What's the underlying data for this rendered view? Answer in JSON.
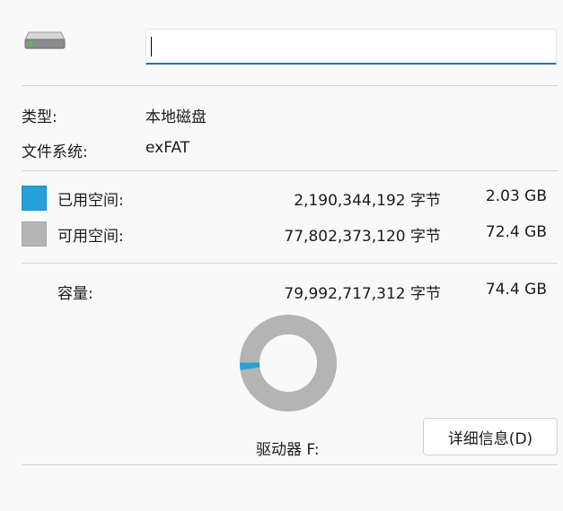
{
  "name_input": {
    "value": ""
  },
  "info": {
    "type_label": "类型:",
    "type_value": "本地磁盘",
    "fs_label": "文件系统:",
    "fs_value": "exFAT"
  },
  "space": {
    "used": {
      "label": "已用空间:",
      "bytes": "2,190,344,192 字节",
      "size": "2.03 GB",
      "color": "#26a0da"
    },
    "free": {
      "label": "可用空间:",
      "bytes": "77,802,373,120 字节",
      "size": "72.4 GB",
      "color": "#b4b4b4"
    },
    "capacity": {
      "label": "容量:",
      "bytes": "79,992,717,312 字节",
      "size": "74.4 GB"
    }
  },
  "chart_data": {
    "type": "pie",
    "categories": [
      "已用空间",
      "可用空间"
    ],
    "values": [
      2190344192,
      77802373120
    ],
    "colors": [
      "#26a0da",
      "#b4b4b4"
    ]
  },
  "drive_label": "驱动器 F:",
  "details_button": "详细信息(D)"
}
